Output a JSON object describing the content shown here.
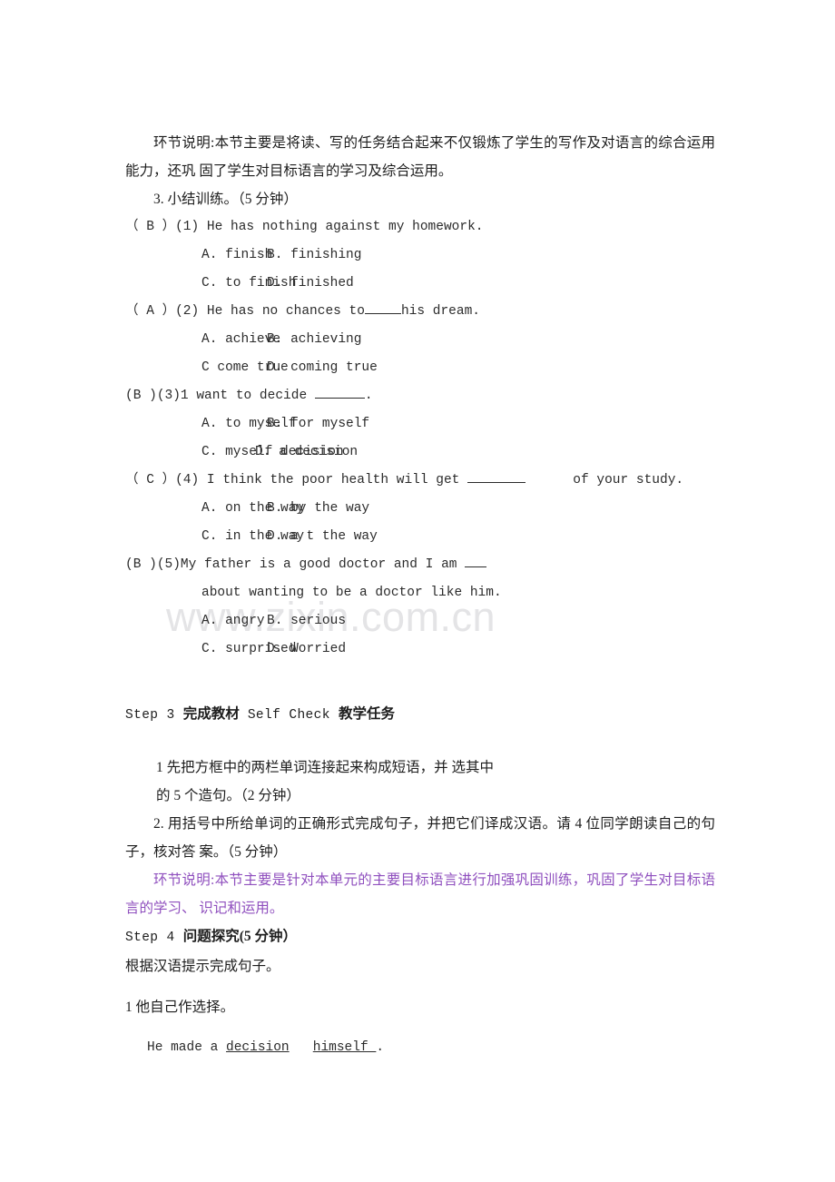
{
  "document": {
    "watermark": "www.zixin.com.cn",
    "accent_purple": "#8f4fbe",
    "text_color": "#1c1c1c",
    "watermark_color": "#e4e4e6"
  },
  "intro": {
    "note_paragraph": "环节说明:本节主要是将读、写的任务结合起来不仅锻炼了学生的写作及对语言的综合运用能力，还巩 固了学生对目标语言的学习及综合运用。",
    "section_3_title": "3.  小结训练。（5 分钟）"
  },
  "questions": [
    {
      "answer": "（ B ）",
      "number": "(1)",
      "stem_before": " He has nothing against my homework.",
      "blank": "none",
      "stem_after": "",
      "options": [
        {
          "label": "A.",
          "text": "finish"
        },
        {
          "label": "B.",
          "text": "finishing"
        },
        {
          "label": "C.",
          "text": "to finish"
        },
        {
          "label": "D.",
          "text": "finished"
        }
      ]
    },
    {
      "answer": "（ A ）",
      "number": "(2)",
      "stem_before": " He has no chances to",
      "blank": "w5",
      "stem_after": "his dream.",
      "options": [
        {
          "label": "A.",
          "text": "achieve"
        },
        {
          "label": "B.",
          "text": "achieving"
        },
        {
          "label": "C",
          "text": "come true"
        },
        {
          "label": "D.",
          "text": "coming true"
        }
      ]
    },
    {
      "answer": "(B )",
      "number": "(3)",
      "stem_before": "1 want to decide ",
      "blank": "w7",
      "stem_after": ".",
      "options": [
        {
          "label": "A.",
          "text": "to myself"
        },
        {
          "label": "B.",
          "text": "for myself"
        },
        {
          "label": "C.",
          "text": "myself decision"
        },
        {
          "label": "D.",
          "text": "a decision"
        }
      ]
    },
    {
      "answer": "（ C ）",
      "number": "(4)",
      "stem_before": " I think the poor health will get ",
      "blank": "w8",
      "stem_after": "      of your study.",
      "options": [
        {
          "label": "A.",
          "text": "on the way"
        },
        {
          "label": "B.",
          "text": "by the way"
        },
        {
          "label": "C.",
          "text": "in the way"
        },
        {
          "label": "D.",
          "text": "a t the way"
        }
      ]
    },
    {
      "answer": "(B )",
      "number": "(5)",
      "stem_before": "My father is a good doctor and I am ",
      "blank": "w3",
      "stem_after": "",
      "continuation": "about wanting to be a doctor like him.",
      "options": [
        {
          "label": "A.",
          "text": "angry"
        },
        {
          "label": "B.",
          "text": "serious"
        },
        {
          "label": "C.",
          "text": "surprised"
        },
        {
          "label": "D.",
          "text": "Worried"
        }
      ]
    }
  ],
  "step3": {
    "head_mono_1": "Step 3 ",
    "head_cn_1": "完成教材",
    "head_mono_2": " Self  Check ",
    "head_cn_2": "教学任务",
    "task1_line1": "1 先把方框中的两栏单词连接起来构成短语，并 选其中",
    "task1_line2": "的 5 个造句。（2 分钟）",
    "task2": "2.  用括号中所给单词的正确形式完成句子，并把它们译成汉语。请 4 位同学朗读自己的句子，核对答 案。（5 分钟）",
    "note": "环节说明:本节主要是针对本单元的主要目标语言进行加强巩固训练，巩固了学生对目标语言的学习、 识记和运用。"
  },
  "step4": {
    "head_mono": "Step 4 ",
    "head_cn": "问题探究(5 分钟）",
    "instruction": "根据汉语提示完成句子。",
    "item1_cn": "1 他自己作选择。",
    "item1_en_prefix": "He made a ",
    "item1_blank1": "decision",
    "item1_gap": "   ",
    "item1_blank2": "himself ",
    "item1_en_suffix": "."
  }
}
